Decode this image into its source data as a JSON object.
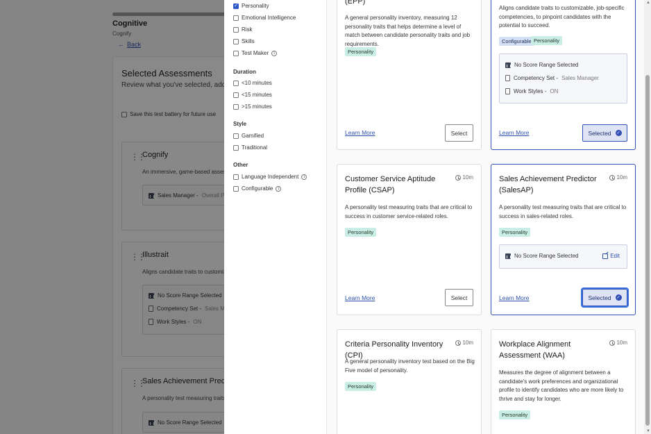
{
  "background": {
    "app_title": "Cognitive",
    "app_subtitle": "Cognify",
    "back_label": "Back",
    "selected_title": "Selected Assessments",
    "selected_subtitle": "Review what you've selected, add mo",
    "save_label": "Save this test battery for future use",
    "cards": [
      {
        "name": "Cognify",
        "desc": "An immersive, game-based assessm",
        "line1": "Sales Manager - ",
        "line1_grey": "Overall Per"
      },
      {
        "name": "Illustrait",
        "desc": "Aligns candidate traits to customizab",
        "line1": "No Score Range Selected",
        "line2": "Competency Set - ",
        "line2_grey": "Sales Ma",
        "line3": "Work Styles - ",
        "line3_grey": "ON"
      },
      {
        "name": "Sales Achievement Predict",
        "desc": "A personality test measuring traits th",
        "line1": "No Score Range Selected"
      }
    ]
  },
  "filters": {
    "types": [
      {
        "label": "Personality",
        "checked": true
      },
      {
        "label": "Emotional Intelligence",
        "checked": false
      },
      {
        "label": "Risk",
        "checked": false
      },
      {
        "label": "Skills",
        "checked": false
      },
      {
        "label": "Test Maker",
        "checked": false
      }
    ],
    "duration_heading": "Duration",
    "durations": [
      "<10 minutes",
      "<15 minutes",
      ">15 minutes"
    ],
    "style_heading": "Style",
    "styles": [
      "Gamified",
      "Traditional"
    ],
    "other_heading": "Other",
    "others": [
      "Language Independent",
      "Configurable"
    ]
  },
  "cards": [
    {
      "title": "(EPP)",
      "desc": "A general personality inventory, measuring 12 personality traits that helps determine a level of match between candidate personality traits and job requirements.",
      "tags": [
        "Personality"
      ],
      "learn": "Learn More",
      "button": "Select"
    },
    {
      "desc": "Aligns candidate traits to customizable, job-specific competencies, to pinpoint candidates with the potential to succeed.",
      "tags": [
        "Configurable",
        "Personality"
      ],
      "score_line1": "No Score Range Selected",
      "score_line2": "Competency Set - ",
      "score_line2_grey": "Sales Manager",
      "score_line3": "Work Styles - ",
      "score_line3_grey": "ON",
      "learn": "Learn More",
      "button": "Selected"
    },
    {
      "title": "Customer Service Aptitude Profile (CSAP)",
      "time": "10m",
      "desc": "A personality test measuring traits that are critical to success in customer service-related roles.",
      "tags": [
        "Personality"
      ],
      "learn": "Learn More",
      "button": "Select"
    },
    {
      "title": "Sales Achievement Predictor (SalesAP)",
      "time": "10m",
      "desc": "A personality test measuring traits that are critical to success in sales-related roles.",
      "tags": [
        "Personality"
      ],
      "score_line1": "No Score Range Selected",
      "edit": "Edit",
      "learn": "Learn More",
      "button": "Selected"
    },
    {
      "title": "Criteria Personality Inventory (CPI)",
      "time": "10m",
      "desc": "A general personality inventory test based on the Big Five model of personality.",
      "tags": [
        "Personality"
      ]
    },
    {
      "title": "Workplace Alignment Assessment (WAA)",
      "time": "10m",
      "desc": "Measures the degree of alignment between a candidate's work preferences and organizational profile to identify candidates who are more likely to thrive and stay for longer.",
      "tags": [
        "Personality"
      ]
    }
  ],
  "colors": {
    "accent": "#3350b4",
    "tag": "#c8eee6",
    "link": "#2b4fa8"
  }
}
